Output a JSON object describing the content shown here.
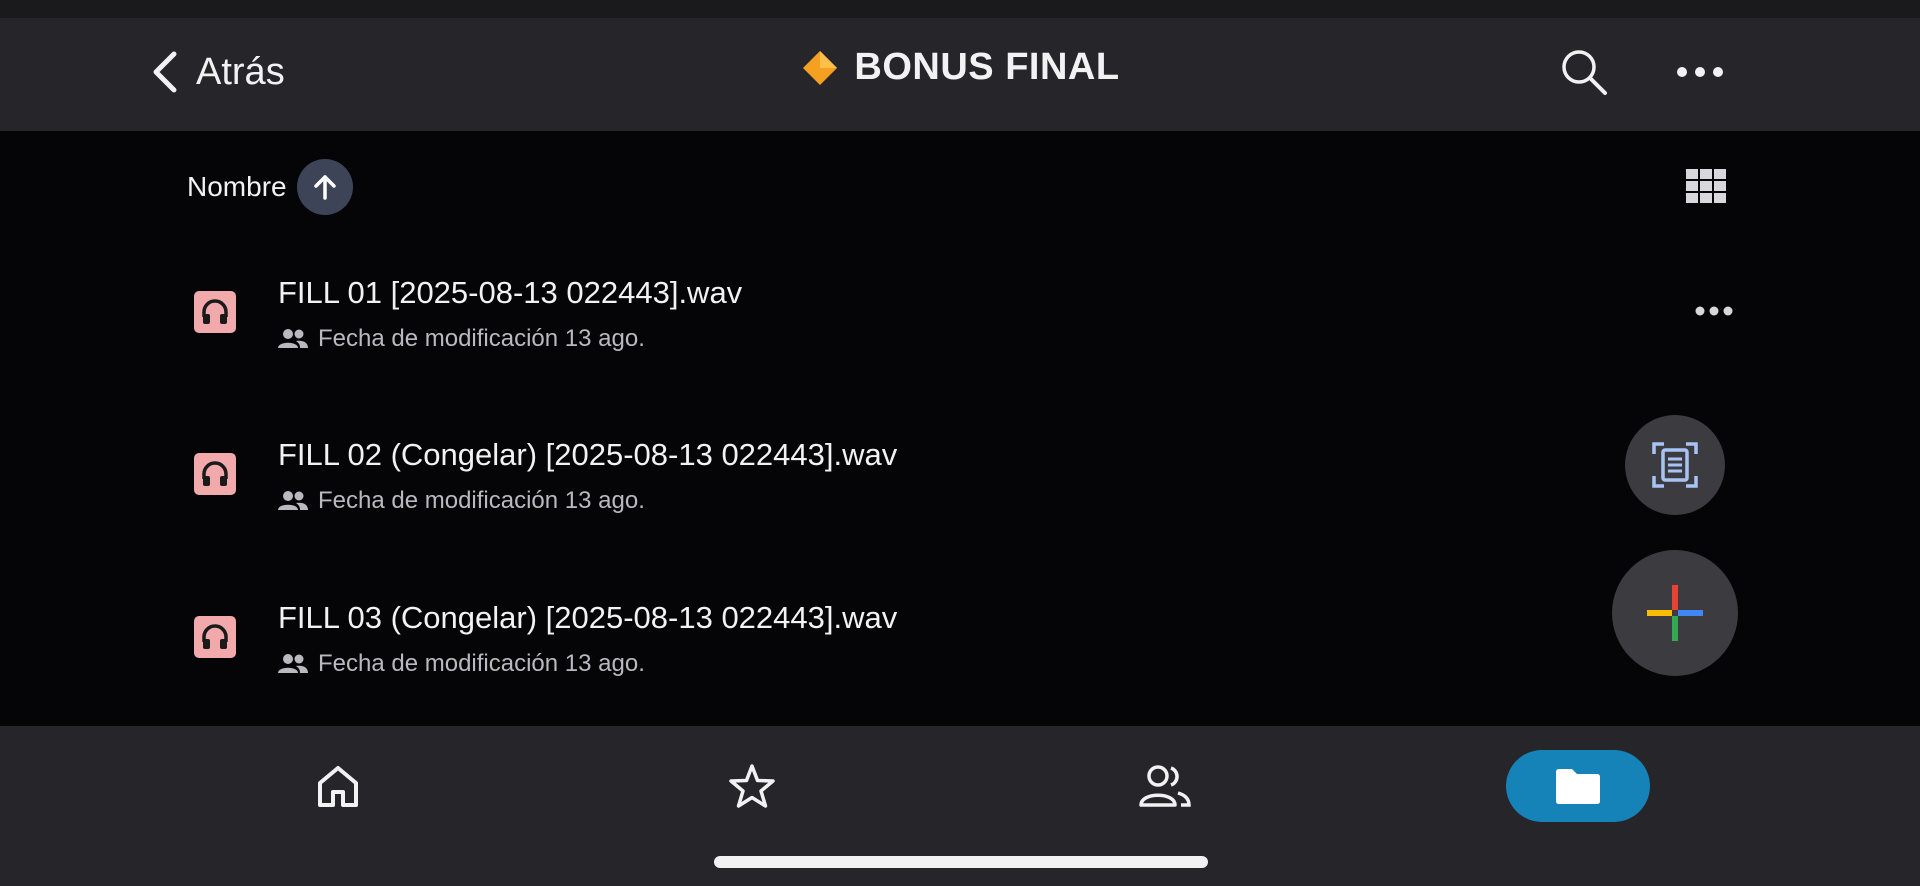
{
  "header": {
    "back_label": "Atrás",
    "title": "BONUS FINAL",
    "title_icon": "orange-diamond-icon",
    "actions": [
      "search-icon",
      "more-horizontal-icon"
    ]
  },
  "sort": {
    "label": "Nombre",
    "direction": "ascending",
    "view_toggle_icon": "grid-view-icon"
  },
  "files": [
    {
      "name": "FILL 01 [2025-08-13 022443].wav",
      "meta": "Fecha de modificación 13 ago.",
      "icon": "audio-file-icon",
      "shared_icon": "people-icon"
    },
    {
      "name": "FILL 02 (Congelar) [2025-08-13 022443].wav",
      "meta": "Fecha de modificación 13 ago.",
      "icon": "audio-file-icon",
      "shared_icon": "people-icon"
    },
    {
      "name": "FILL 03 (Congelar) [2025-08-13 022443].wav",
      "meta": "Fecha de modificación 13 ago.",
      "icon": "audio-file-icon",
      "shared_icon": "people-icon"
    }
  ],
  "fabs": [
    "scan-document-icon",
    "plus-icon"
  ],
  "bottom_nav": {
    "items": [
      "home-icon",
      "star-icon",
      "shared-people-icon",
      "folder-icon"
    ],
    "active": "folder-icon"
  },
  "colors": {
    "header_bg": "#26262a",
    "content_bg": "#050507",
    "file_icon_bg": "#f2a9ac",
    "active_nav": "#1683b8",
    "sort_button_bg": "#3d4457",
    "diamond": "#f5a020"
  }
}
